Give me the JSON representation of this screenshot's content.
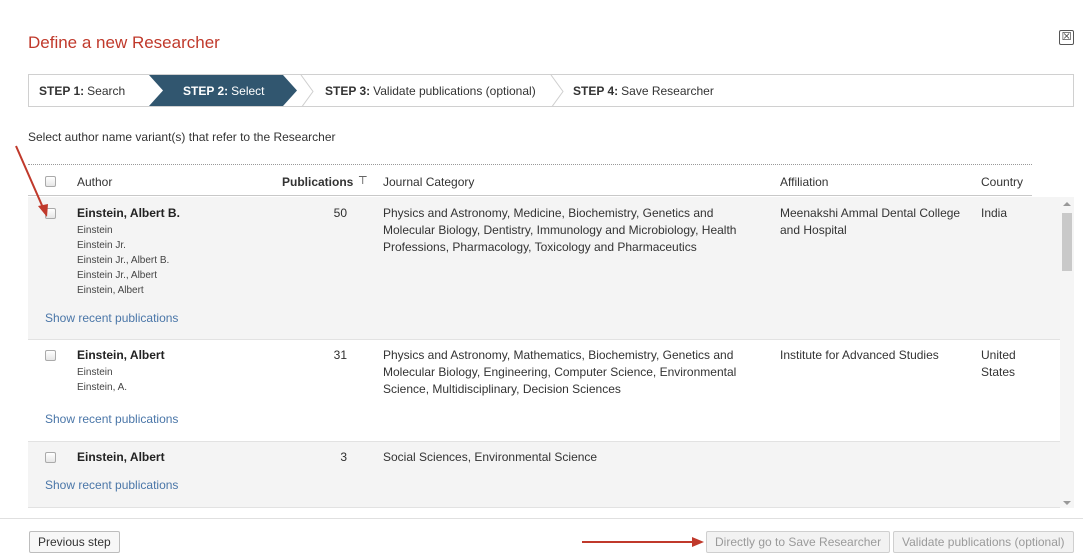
{
  "dialog": {
    "title": "Define a new Researcher",
    "close_icon": "close-icon",
    "close_glyph": "☒"
  },
  "steps": [
    {
      "prefix": "STEP 1:",
      "label": "Search",
      "state": "done"
    },
    {
      "prefix": "STEP 2:",
      "label": "Select",
      "state": "active"
    },
    {
      "prefix": "STEP 3:",
      "label": "Validate publications (optional)",
      "state": "pending"
    },
    {
      "prefix": "STEP 4:",
      "label": "Save Researcher",
      "state": "pending"
    }
  ],
  "intro_text": "Select author name variant(s) that refer to the Researcher",
  "table": {
    "headers": {
      "author": "Author",
      "publications": "Publications",
      "sort_icon": "sort-icon",
      "sort_glyph": "⊤",
      "journal_category": "Journal Category",
      "affiliation": "Affiliation",
      "country": "Country"
    },
    "rows": [
      {
        "name": "Einstein, Albert B.",
        "variants": [
          "Einstein",
          "Einstein Jr.",
          "Einstein Jr., Albert B.",
          "Einstein Jr., Albert",
          "Einstein, Albert"
        ],
        "publications": "50",
        "journal_category": "Physics and Astronomy, Medicine, Biochemistry, Genetics and Molecular Biology, Dentistry, Immunology and Microbiology, Health Professions, Pharmacology, Toxicology and Pharmaceutics",
        "affiliation": "Meenakshi Ammal Dental College and Hospital",
        "country": "India",
        "show_link": "Show recent publications",
        "checked": false
      },
      {
        "name": "Einstein, Albert",
        "variants": [
          "Einstein",
          "Einstein, A."
        ],
        "publications": "31",
        "journal_category": "Physics and Astronomy, Mathematics, Biochemistry, Genetics and Molecular Biology, Engineering, Computer Science, Environmental Science, Multidisciplinary, Decision Sciences",
        "affiliation": "Institute for Advanced Studies",
        "country": "United States",
        "show_link": "Show recent publications",
        "checked": false
      },
      {
        "name": "Einstein, Albert",
        "variants": [],
        "publications": "3",
        "journal_category": "Social Sciences, Environmental Science",
        "affiliation": "",
        "country": "",
        "show_link": "Show recent publications",
        "checked": false
      }
    ]
  },
  "footer": {
    "previous_label": "Previous step",
    "save_label": "Directly go to Save Researcher",
    "validate_label": "Validate publications (optional)"
  },
  "annotation_color": "#c0392b",
  "colors": {
    "title": "#c0392b",
    "active_step": "#31566f",
    "link": "#4a76a8"
  }
}
